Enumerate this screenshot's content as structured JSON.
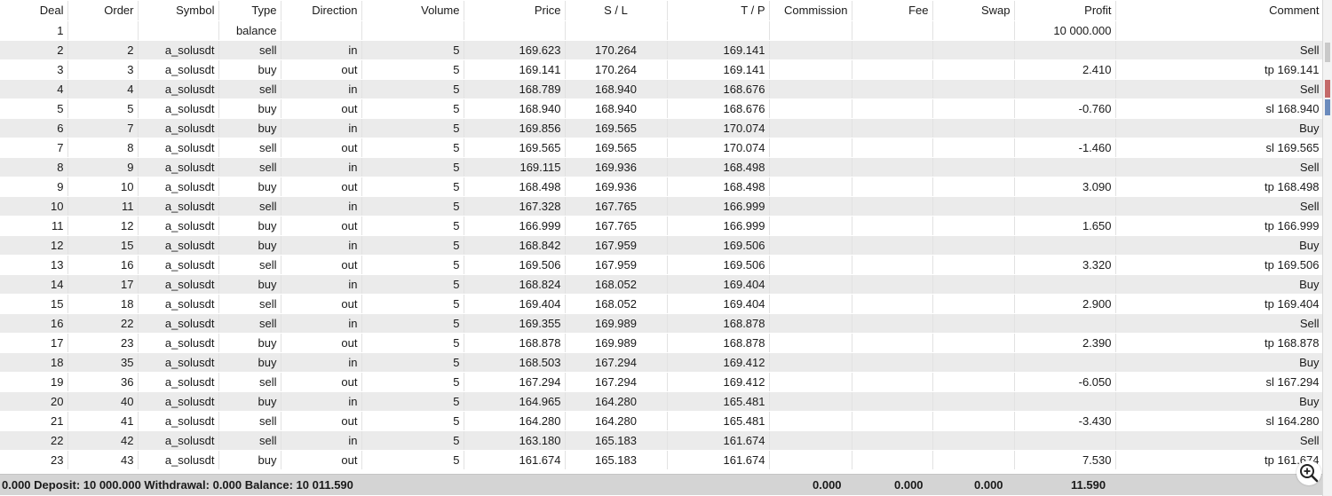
{
  "columns": [
    "Deal",
    "Order",
    "Symbol",
    "Type",
    "Direction",
    "Volume",
    "Price",
    "S / L",
    "T / P",
    "Commission",
    "Fee",
    "Swap",
    "Profit",
    "Comment"
  ],
  "rows": [
    [
      "1",
      "",
      "",
      "balance",
      "",
      "",
      "",
      "",
      "",
      "",
      "",
      "",
      "10 000.000",
      ""
    ],
    [
      "2",
      "2",
      "a_solusdt",
      "sell",
      "in",
      "5",
      "169.623",
      "170.264",
      "169.141",
      "",
      "",
      "",
      "",
      "Sell"
    ],
    [
      "3",
      "3",
      "a_solusdt",
      "buy",
      "out",
      "5",
      "169.141",
      "170.264",
      "169.141",
      "",
      "",
      "",
      "2.410",
      "tp 169.141"
    ],
    [
      "4",
      "4",
      "a_solusdt",
      "sell",
      "in",
      "5",
      "168.789",
      "168.940",
      "168.676",
      "",
      "",
      "",
      "",
      "Sell"
    ],
    [
      "5",
      "5",
      "a_solusdt",
      "buy",
      "out",
      "5",
      "168.940",
      "168.940",
      "168.676",
      "",
      "",
      "",
      "-0.760",
      "sl 168.940"
    ],
    [
      "6",
      "7",
      "a_solusdt",
      "buy",
      "in",
      "5",
      "169.856",
      "169.565",
      "170.074",
      "",
      "",
      "",
      "",
      "Buy"
    ],
    [
      "7",
      "8",
      "a_solusdt",
      "sell",
      "out",
      "5",
      "169.565",
      "169.565",
      "170.074",
      "",
      "",
      "",
      "-1.460",
      "sl 169.565"
    ],
    [
      "8",
      "9",
      "a_solusdt",
      "sell",
      "in",
      "5",
      "169.115",
      "169.936",
      "168.498",
      "",
      "",
      "",
      "",
      "Sell"
    ],
    [
      "9",
      "10",
      "a_solusdt",
      "buy",
      "out",
      "5",
      "168.498",
      "169.936",
      "168.498",
      "",
      "",
      "",
      "3.090",
      "tp 168.498"
    ],
    [
      "10",
      "11",
      "a_solusdt",
      "sell",
      "in",
      "5",
      "167.328",
      "167.765",
      "166.999",
      "",
      "",
      "",
      "",
      "Sell"
    ],
    [
      "11",
      "12",
      "a_solusdt",
      "buy",
      "out",
      "5",
      "166.999",
      "167.765",
      "166.999",
      "",
      "",
      "",
      "1.650",
      "tp 166.999"
    ],
    [
      "12",
      "15",
      "a_solusdt",
      "buy",
      "in",
      "5",
      "168.842",
      "167.959",
      "169.506",
      "",
      "",
      "",
      "",
      "Buy"
    ],
    [
      "13",
      "16",
      "a_solusdt",
      "sell",
      "out",
      "5",
      "169.506",
      "167.959",
      "169.506",
      "",
      "",
      "",
      "3.320",
      "tp 169.506"
    ],
    [
      "14",
      "17",
      "a_solusdt",
      "buy",
      "in",
      "5",
      "168.824",
      "168.052",
      "169.404",
      "",
      "",
      "",
      "",
      "Buy"
    ],
    [
      "15",
      "18",
      "a_solusdt",
      "sell",
      "out",
      "5",
      "169.404",
      "168.052",
      "169.404",
      "",
      "",
      "",
      "2.900",
      "tp 169.404"
    ],
    [
      "16",
      "22",
      "a_solusdt",
      "sell",
      "in",
      "5",
      "169.355",
      "169.989",
      "168.878",
      "",
      "",
      "",
      "",
      "Sell"
    ],
    [
      "17",
      "23",
      "a_solusdt",
      "buy",
      "out",
      "5",
      "168.878",
      "169.989",
      "168.878",
      "",
      "",
      "",
      "2.390",
      "tp 168.878"
    ],
    [
      "18",
      "35",
      "a_solusdt",
      "buy",
      "in",
      "5",
      "168.503",
      "167.294",
      "169.412",
      "",
      "",
      "",
      "",
      "Buy"
    ],
    [
      "19",
      "36",
      "a_solusdt",
      "sell",
      "out",
      "5",
      "167.294",
      "167.294",
      "169.412",
      "",
      "",
      "",
      "-6.050",
      "sl 167.294"
    ],
    [
      "20",
      "40",
      "a_solusdt",
      "buy",
      "in",
      "5",
      "164.965",
      "164.280",
      "165.481",
      "",
      "",
      "",
      "",
      "Buy"
    ],
    [
      "21",
      "41",
      "a_solusdt",
      "sell",
      "out",
      "5",
      "164.280",
      "164.280",
      "165.481",
      "",
      "",
      "",
      "-3.430",
      "sl 164.280"
    ],
    [
      "22",
      "42",
      "a_solusdt",
      "sell",
      "in",
      "5",
      "163.180",
      "165.183",
      "161.674",
      "",
      "",
      "",
      "",
      "Sell"
    ],
    [
      "23",
      "43",
      "a_solusdt",
      "buy",
      "out",
      "5",
      "161.674",
      "165.183",
      "161.674",
      "",
      "",
      "",
      "7.530",
      "tp 161.674"
    ]
  ],
  "footer": {
    "summary": "0.000  Deposit: 10 000.000  Withdrawal: 0.000  Balance: 10 011.590",
    "commission": "0.000",
    "fee": "0.000",
    "swap": "0.000",
    "profit": "11.590"
  },
  "icons": {
    "zoom": "zoom-in-icon"
  },
  "colors": {
    "header_bg": "#ffffff",
    "row_alt": "#ebebeb",
    "footer_bg": "#d4d4d4"
  }
}
